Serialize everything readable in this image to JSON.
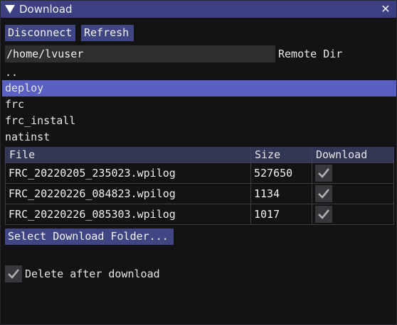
{
  "window": {
    "title": "Download",
    "close_glyph": "✕",
    "collapse_icon": "triangle-down-icon"
  },
  "toolbar": {
    "disconnect_label": "Disconnect",
    "refresh_label": "Refresh"
  },
  "remote_dir": {
    "value": "/home/lvuser",
    "label": "Remote Dir"
  },
  "directories": [
    {
      "name": "..",
      "selected": false
    },
    {
      "name": "deploy",
      "selected": true
    },
    {
      "name": "frc",
      "selected": false
    },
    {
      "name": "frc_install",
      "selected": false
    },
    {
      "name": "natinst",
      "selected": false
    }
  ],
  "files_table": {
    "headers": {
      "file": "File",
      "size": "Size",
      "download": "Download"
    },
    "rows": [
      {
        "file": "FRC_20220205_235023.wpilog",
        "size": "527650",
        "download": true
      },
      {
        "file": "FRC_20220226_084823.wpilog",
        "size": "1134",
        "download": true
      },
      {
        "file": "FRC_20220226_085303.wpilog",
        "size": "1017",
        "download": true
      }
    ]
  },
  "select_folder_label": "Select Download Folder...",
  "delete_after": {
    "label": "Delete after download",
    "checked": true
  },
  "colors": {
    "titlebar": "#3c3f82",
    "button": "#3f4683",
    "selected": "#5a5fc2",
    "table_header": "#333756"
  }
}
